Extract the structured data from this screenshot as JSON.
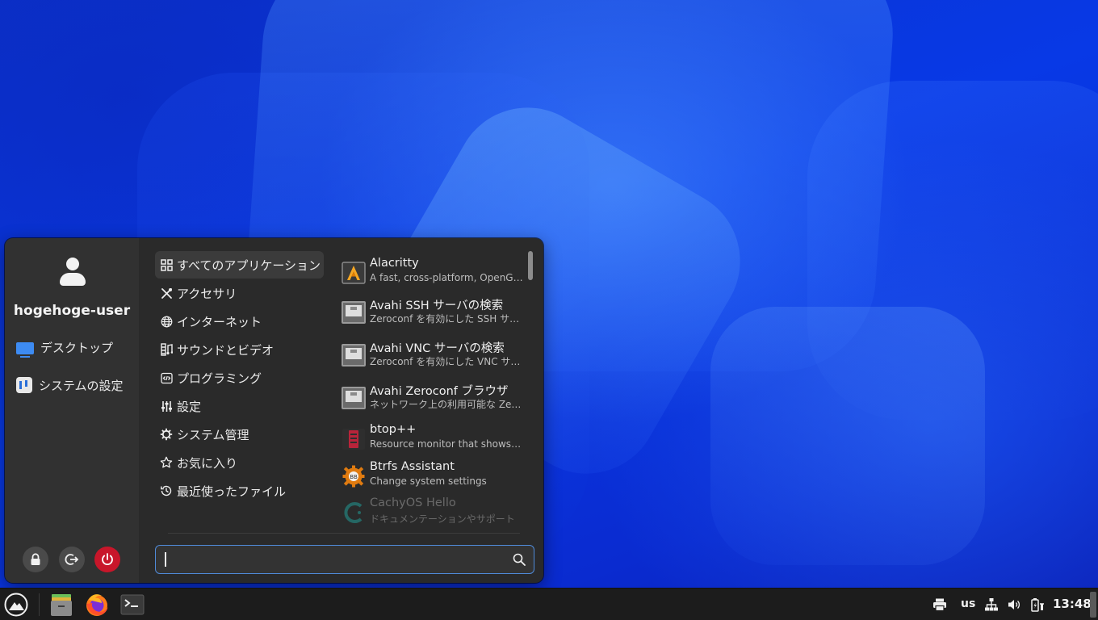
{
  "user": {
    "name": "hogehoge-user"
  },
  "places": [
    {
      "label": "デスクトップ",
      "icon": "desktop-icon"
    },
    {
      "label": "システムの設定",
      "icon": "settings-manager-icon"
    }
  ],
  "actions": [
    {
      "name": "lock",
      "icon": "lock-icon"
    },
    {
      "name": "logout",
      "icon": "logout-icon"
    },
    {
      "name": "power",
      "icon": "power-icon",
      "color": "#c8162a"
    }
  ],
  "categories": [
    {
      "label": "すべてのアプリケーション",
      "icon": "grid-icon",
      "active": true
    },
    {
      "label": "アクセサリ",
      "icon": "tools-icon"
    },
    {
      "label": "インターネット",
      "icon": "globe-icon"
    },
    {
      "label": "サウンドとビデオ",
      "icon": "film-music-icon"
    },
    {
      "label": "プログラミング",
      "icon": "code-icon"
    },
    {
      "label": "設定",
      "icon": "sliders-icon"
    },
    {
      "label": "システム管理",
      "icon": "gear-icon"
    },
    {
      "label": "お気に入り",
      "icon": "star-icon"
    },
    {
      "label": "最近使ったファイル",
      "icon": "history-icon"
    }
  ],
  "apps": [
    {
      "name": "Alacritty",
      "desc": "A fast, cross-platform, OpenGL terminal emulator",
      "icon": "alacritty-icon"
    },
    {
      "name": "Avahi SSH サーバの検索",
      "desc": "Zeroconf を有効にした SSH サーバを検索します",
      "icon": "network-monitor-icon"
    },
    {
      "name": "Avahi VNC サーバの検索",
      "desc": "Zeroconf を有効にした VNC サーバを検索します",
      "icon": "network-monitor-icon"
    },
    {
      "name": "Avahi Zeroconf ブラウザ",
      "desc": "ネットワーク上の利用可能な Zeroconf サービスを閲覧します",
      "icon": "network-monitor-icon"
    },
    {
      "name": "btop++",
      "desc": "Resource monitor that shows usage and stats",
      "icon": "btop-icon"
    },
    {
      "name": "Btrfs Assistant",
      "desc": "Change system settings",
      "icon": "btrfs-assistant-icon"
    },
    {
      "name": "CachyOS Hello",
      "desc": "ドキュメンテーションやサポート",
      "icon": "cachyos-icon"
    }
  ],
  "search": {
    "value": "",
    "placeholder": ""
  },
  "taskbar": {
    "apps": [
      "cachyos-menu-icon",
      "file-manager-icon",
      "firefox-icon",
      "terminal-icon"
    ],
    "keyboard_layout": "us",
    "clock": "13:48"
  },
  "colors": {
    "accent": "#4f8ad8",
    "wallpaper": "#0a2fd8",
    "menu_bg": "#2a2a2a",
    "power": "#c8162a"
  }
}
